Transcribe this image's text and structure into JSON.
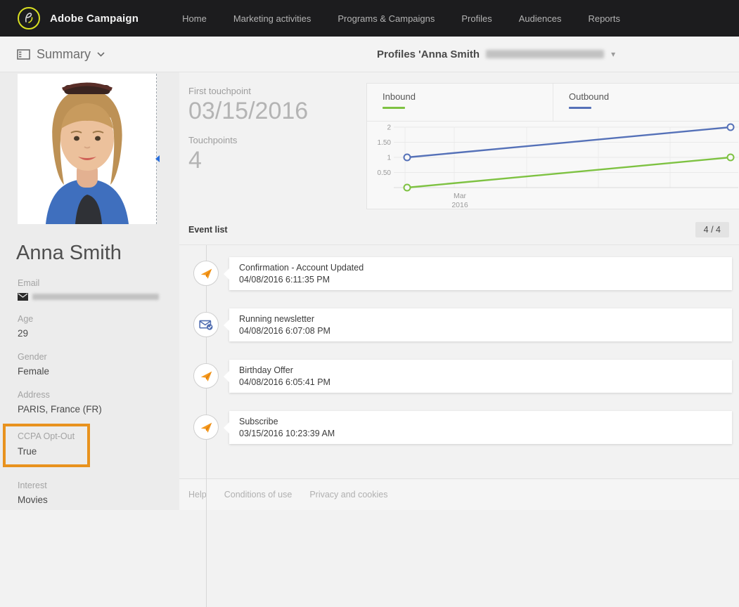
{
  "brand": {
    "name": "Adobe Campaign"
  },
  "nav": {
    "items": [
      "Home",
      "Marketing activities",
      "Programs & Campaigns",
      "Profiles",
      "Audiences",
      "Reports"
    ]
  },
  "toolbar": {
    "view_label": "Summary",
    "context_label": "Profiles 'Anna Smith",
    "context_redacted": true,
    "caret": "▾"
  },
  "profile": {
    "name": "Anna Smith",
    "fields": [
      {
        "label": "Email",
        "value": "",
        "redacted": true
      },
      {
        "label": "Age",
        "value": "29"
      },
      {
        "label": "Gender",
        "value": "Female"
      },
      {
        "label": "Address",
        "value": "PARIS, France (FR)"
      },
      {
        "label": "CCPA Opt-Out",
        "value": "True",
        "highlighted": true
      },
      {
        "label": "Interest",
        "value": "Movies"
      }
    ]
  },
  "stats": {
    "first_touchpoint_label": "First touchpoint",
    "first_touchpoint_value": "03/15/2016",
    "touchpoints_label": "Touchpoints",
    "touchpoints_value": "4"
  },
  "chart_data": {
    "type": "line",
    "x": [
      "03/15/2016",
      "04/08/2016"
    ],
    "xtick_labels": [
      "Mar",
      "2016"
    ],
    "series": [
      {
        "name": "Inbound",
        "color": "#7EC242",
        "values": [
          0,
          1
        ]
      },
      {
        "name": "Outbound",
        "color": "#5571B8",
        "values": [
          1,
          2
        ]
      }
    ],
    "ytick_values": [
      0.5,
      1,
      1.5,
      2
    ],
    "ytick_labels": [
      "0.50",
      "1",
      "1.50",
      "2"
    ],
    "ylim": [
      0,
      2.3
    ],
    "grid": true,
    "legend_position": "top"
  },
  "events": {
    "header": "Event list",
    "count_badge": "4 / 4",
    "items": [
      {
        "icon": "paper-plane",
        "title": "Confirmation - Account Updated",
        "datetime": "04/08/2016 6:11:35 PM"
      },
      {
        "icon": "recurring-email",
        "title": "Running newsletter",
        "datetime": "04/08/2016 6:07:08 PM"
      },
      {
        "icon": "paper-plane",
        "title": "Birthday Offer",
        "datetime": "04/08/2016 6:05:41 PM"
      },
      {
        "icon": "paper-plane",
        "title": "Subscribe",
        "datetime": "03/15/2016 10:23:39 AM"
      }
    ]
  },
  "footer": {
    "links": [
      "Help",
      "Conditions of use",
      "Privacy and cookies"
    ]
  },
  "colors": {
    "highlight_orange": "#E8921E",
    "inbound_green": "#7EC242",
    "outbound_blue": "#5571B8",
    "paper_plane_orange": "#F5991D",
    "nav_bg": "#1C1C1E",
    "logo_ring": "#D9E021"
  }
}
